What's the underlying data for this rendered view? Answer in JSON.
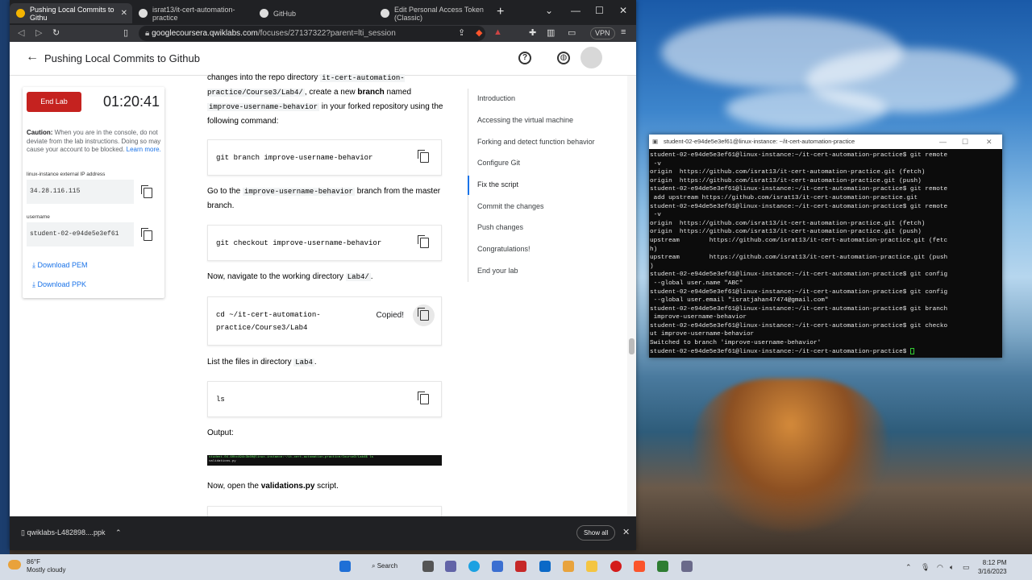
{
  "browser": {
    "tabs": [
      {
        "label": "Pushing Local Commits to Githu",
        "active": true
      },
      {
        "label": "israt13/it-cert-automation-practice"
      },
      {
        "label": "GitHub"
      },
      {
        "label": "Edit Personal Access Token (Classic)"
      }
    ],
    "url_host": "googlecoursera.qwiklabs.com",
    "url_path": "/focuses/27137322?parent=lti_session",
    "vpn": "VPN"
  },
  "app": {
    "title": "Pushing Local Commits to Github",
    "help_icon": "?",
    "end_lab": "End Lab",
    "timer": "01:20:41",
    "caution_bold": "Caution:",
    "caution_text": " When you are in the console, do not deviate from the lab instructions. Doing so may cause your account to be blocked. ",
    "learn_more": "Learn more.",
    "ip_label": "linux-instance external IP address",
    "ip_value": "34.28.116.115",
    "username_label": "username",
    "username_value": "student-02-e94de5e3ef61",
    "download_pem": "Download PEM",
    "download_ppk": "Download PPK"
  },
  "content": {
    "p1a": "changes into the repo directory ",
    "p1code": "it-cert-automation-practice/Course3/Lab4/",
    "p1b": ", create a new ",
    "p1bold": "branch",
    "p1c": " named ",
    "p1code2": "improve-username-behavior",
    "p1d": " in your forked repository using the following command:",
    "cmd1": "git branch improve-username-behavior",
    "p2a": "Go to the ",
    "p2code": "improve-username-behavior",
    "p2b": " branch from the master branch.",
    "cmd2": "git checkout improve-username-behavior",
    "p3a": "Now, navigate to the working directory ",
    "p3code": "Lab4/",
    "p3b": ".",
    "cmd3a": "cd ~/it-cert-automation-",
    "cmd3b": "practice/Course3/Lab4",
    "copied": "Copied!",
    "p4a": "List the files in directory ",
    "p4code": "Lab4",
    "p4b": ".",
    "cmd4": "ls",
    "output_label": "Output:",
    "output_line1": "student-04-60bc494c3b60@linux-instance:~/it-cert-automation-practice/Course3/Lab4$ ls",
    "output_line2": "validations.py",
    "p5a": "Now, open the ",
    "p5bold": "validations.py",
    "p5b": " script."
  },
  "toc": [
    "Introduction",
    "Accessing the virtual machine",
    "Forking and detect function behavior",
    "Configure Git",
    "Fix the script",
    "Commit the changes",
    "Push changes",
    "Congratulations!",
    "End your lab"
  ],
  "toc_active": "Fix the script",
  "downloads": {
    "file": "qwiklabs-L482898....ppk",
    "show_all": "Show all"
  },
  "terminal": {
    "title": "student-02-e94de5e3ef61@linux-instance: ~/it-cert-automation-practice",
    "lines": [
      "student-02-e94de5e3ef61@linux-instance:~/it-cert-automation-practice$ git remote",
      " -v",
      "origin  https://github.com/israt13/it-cert-automation-practice.git (fetch)",
      "origin  https://github.com/israt13/it-cert-automation-practice.git (push)",
      "student-02-e94de5e3ef61@linux-instance:~/it-cert-automation-practice$ git remote",
      " add upstream https://github.com/israt13/it-cert-automation-practice.git",
      "student-02-e94de5e3ef61@linux-instance:~/it-cert-automation-practice$ git remote",
      " -v",
      "origin  https://github.com/israt13/it-cert-automation-practice.git (fetch)",
      "origin  https://github.com/israt13/it-cert-automation-practice.git (push)",
      "upstream        https://github.com/israt13/it-cert-automation-practice.git (fetc",
      "h)",
      "upstream        https://github.com/israt13/it-cert-automation-practice.git (push",
      ")",
      "student-02-e94de5e3ef61@linux-instance:~/it-cert-automation-practice$ git config",
      " --global user.name \"ABC\"",
      "student-02-e94de5e3ef61@linux-instance:~/it-cert-automation-practice$ git config",
      " --global user.email \"isratjahan47474@gmail.com\"",
      "student-02-e94de5e3ef61@linux-instance:~/it-cert-automation-practice$ git branch",
      " improve-username-behavior",
      "student-02-e94de5e3ef61@linux-instance:~/it-cert-automation-practice$ git checko",
      "ut improve-username-behavior",
      "Switched to branch 'improve-username-behavior'",
      "student-02-e94de5e3ef61@linux-instance:~/it-cert-automation-practice$ "
    ]
  },
  "taskbar": {
    "temp": "86°F",
    "weather": "Mostly cloudy",
    "search": "Search",
    "time": "8:12 PM",
    "date": "3/16/2023"
  }
}
